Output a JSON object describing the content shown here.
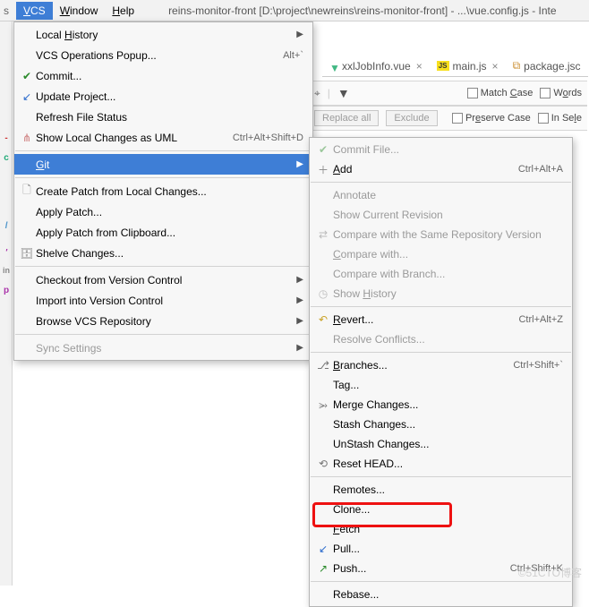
{
  "menubar": {
    "left_stub": "s",
    "vcs": "VCS",
    "window": "Window",
    "help": "Help",
    "title": "reins-monitor-front [D:\\project\\newreins\\reins-monitor-front] - ...\\vue.config.js - Inte"
  },
  "tabs": {
    "t1": "xxlJobInfo.vue",
    "t2": "main.js",
    "t3": "package.jsc"
  },
  "findbar": {
    "replace": "Replace all",
    "exclude": "Exclude",
    "match_case": "Match Case",
    "words": "Words",
    "preserve_case": "Preserve Case",
    "in_sel": "In Sele"
  },
  "gutter": {
    "a": "-",
    "b": "c",
    "c": "l",
    "d": "'",
    "e": "in",
    "f": "p"
  },
  "vcs_menu": {
    "local_history": "Local History",
    "ops_popup": "VCS Operations Popup...",
    "ops_popup_sc": "Alt+`",
    "commit": "Commit...",
    "update": "Update Project...",
    "refresh": "Refresh File Status",
    "uml": "Show Local Changes as UML",
    "uml_sc": "Ctrl+Alt+Shift+D",
    "git": "Git",
    "create_patch": "Create Patch from Local Changes...",
    "apply_patch": "Apply Patch...",
    "apply_patch_clip": "Apply Patch from Clipboard...",
    "shelve": "Shelve Changes...",
    "checkout": "Checkout from Version Control",
    "import": "Import into Version Control",
    "browse": "Browse VCS Repository",
    "sync": "Sync Settings"
  },
  "git_menu": {
    "commit_file": "Commit File...",
    "add": "Add",
    "add_sc": "Ctrl+Alt+A",
    "annotate": "Annotate",
    "show_current": "Show Current Revision",
    "compare_same": "Compare with the Same Repository Version",
    "compare_with": "Compare with...",
    "compare_branch": "Compare with Branch...",
    "show_history": "Show History",
    "revert": "Revert...",
    "revert_sc": "Ctrl+Alt+Z",
    "resolve": "Resolve Conflicts...",
    "branches": "Branches...",
    "branches_sc": "Ctrl+Shift+`",
    "tag": "Tag...",
    "merge": "Merge Changes...",
    "stash": "Stash Changes...",
    "unstash": "UnStash Changes...",
    "reset": "Reset HEAD...",
    "remotes": "Remotes...",
    "clone": "Clone...",
    "fetch": "Fetch",
    "pull": "Pull...",
    "push": "Push...",
    "push_sc": "Ctrl+Shift+K",
    "rebase": "Rebase..."
  },
  "watermark": "©51CTO博客"
}
